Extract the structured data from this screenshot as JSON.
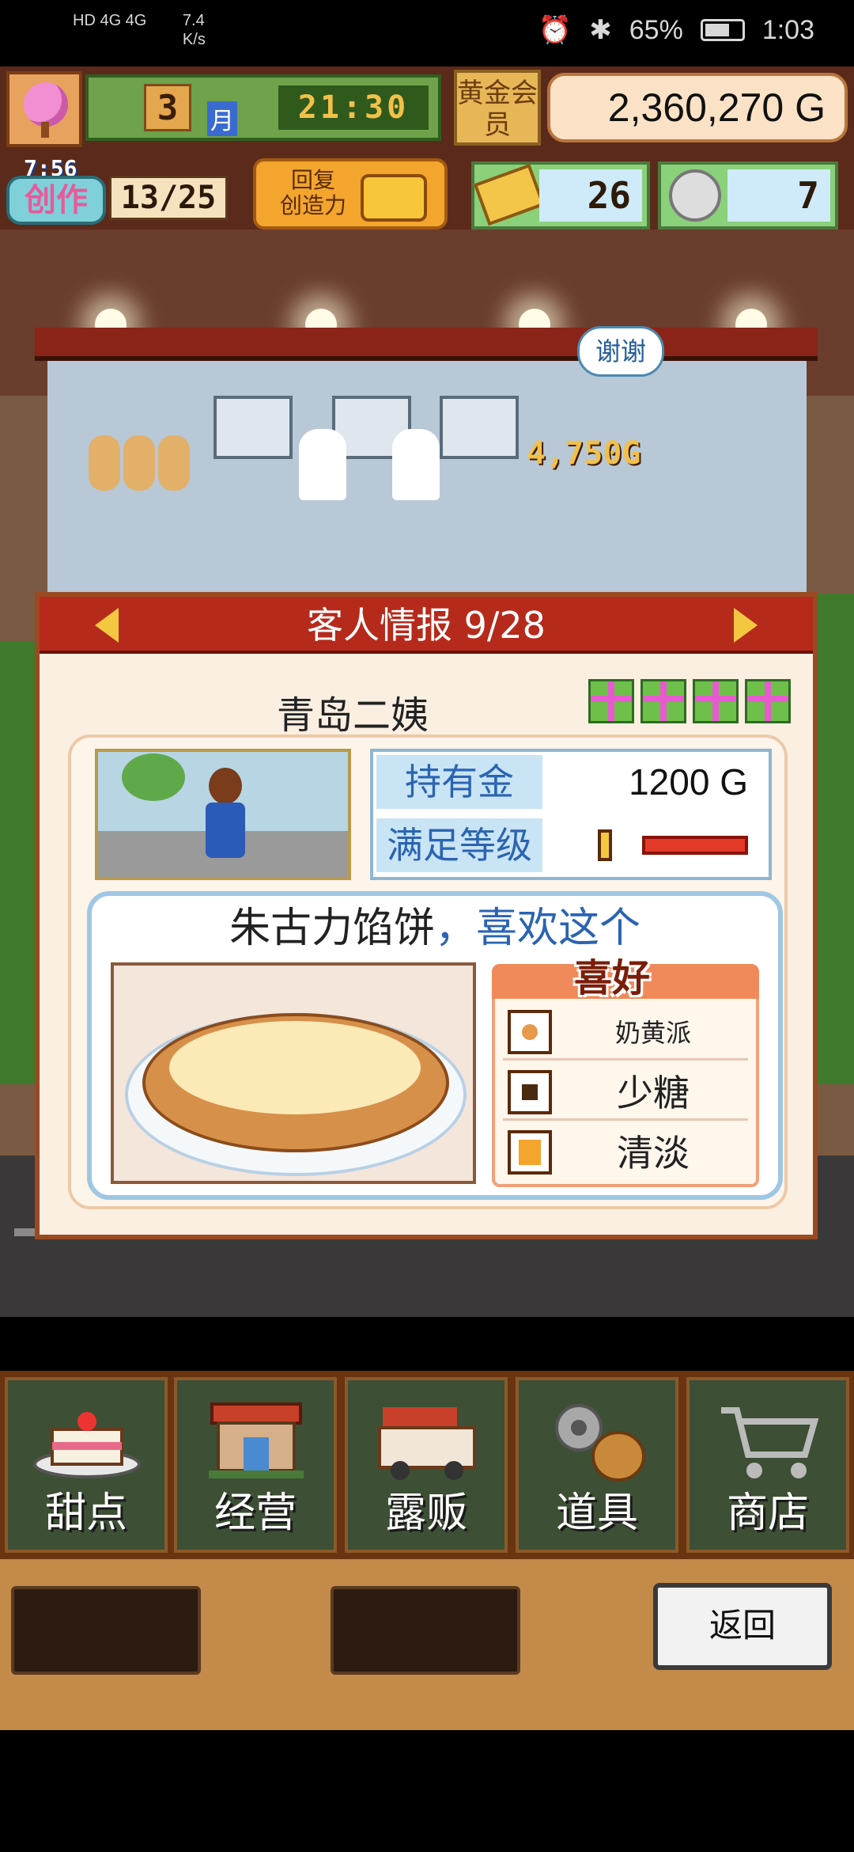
{
  "status_bar": {
    "network": "HD 4G 4G",
    "speed": "7.4\nK/s",
    "battery": "65%",
    "time": "1:03"
  },
  "hud": {
    "month_value": "3",
    "month_label": "月",
    "clock": "21:30",
    "member_label": "黄金会员",
    "money": "2,360,270 G",
    "creation_timer": "7:56",
    "creation_label": "创作",
    "creation_count": "13/25",
    "restore_label": "回复\n创造力",
    "tickets": "26",
    "coins": "7"
  },
  "scene": {
    "bubble": "谢谢",
    "earning": "4,750G"
  },
  "customer_panel": {
    "title": "客人情报 9/28",
    "name": "青岛二姨",
    "gift_count": 4,
    "money_label": "持有金",
    "money_value": "1200 G",
    "satisfaction_label": "满足等级",
    "satisfaction_level": 1.0,
    "favorite_item": "朱古力馅饼",
    "favorite_tail": "，喜欢这个",
    "preferences_title": "喜好",
    "preferences": [
      {
        "label": "奶黄派",
        "icon": "pie-icon",
        "color": "#e89a4a"
      },
      {
        "label": "少糖",
        "icon": "sugar-icon",
        "color": "#4a2a10"
      },
      {
        "label": "清淡",
        "icon": "light-flavor-icon",
        "color": "#f3a52d"
      }
    ]
  },
  "bottom_nav": {
    "items": [
      {
        "label": "甜点",
        "icon": "cake-icon"
      },
      {
        "label": "经营",
        "icon": "shop-icon"
      },
      {
        "label": "露贩",
        "icon": "food-truck-icon"
      },
      {
        "label": "道具",
        "icon": "tools-icon"
      },
      {
        "label": "商店",
        "icon": "cart-icon"
      }
    ],
    "back_label": "返回"
  }
}
